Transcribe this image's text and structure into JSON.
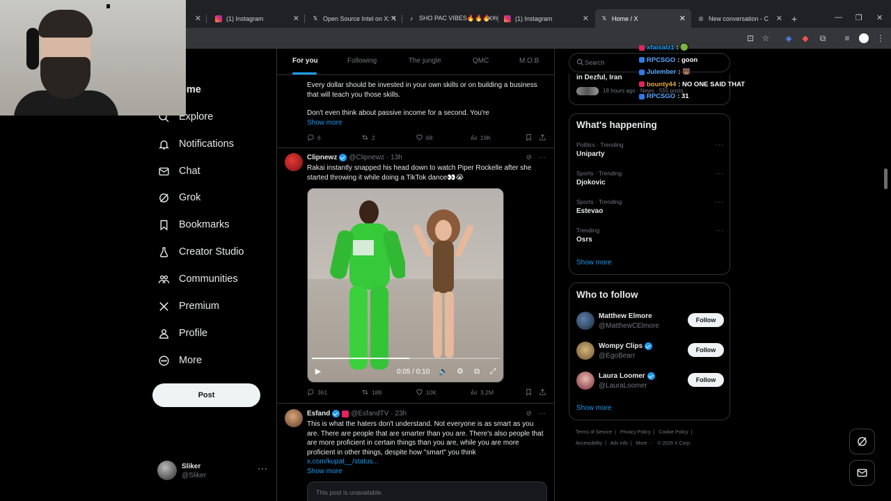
{
  "browser": {
    "tabs": [
      {
        "label": "",
        "favicon": "instagram-icon"
      },
      {
        "label": "(1) Instagram",
        "favicon": "instagram-icon"
      },
      {
        "label": "Open Source Intel on X: \"I",
        "favicon": "x-icon"
      },
      {
        "label": "SHO PAC VIBES🔥🔥🔥 #s",
        "favicon": "tiktok-icon"
      },
      {
        "label": "(1) Instagram",
        "favicon": "instagram-icon"
      },
      {
        "label": "Home / X",
        "favicon": "x-icon"
      },
      {
        "label": "New conversation - C",
        "favicon": "chat-icon"
      }
    ]
  },
  "nav": {
    "home": "ome",
    "explore": "Explore",
    "notifications": "Notifications",
    "chat": "Chat",
    "grok": "Grok",
    "bookmarks": "Bookmarks",
    "creator_studio": "Creator Studio",
    "communities": "Communities",
    "premium": "Premium",
    "profile": "Profile",
    "more": "More",
    "post": "Post"
  },
  "account": {
    "name": "Sliker",
    "handle": "@Sliker"
  },
  "feed_tabs": [
    "For you",
    "Following",
    "The jungle",
    "QMC",
    "M.O.B"
  ],
  "posts": {
    "first": {
      "text1": "Every dollar should be invested in your own skills or on building a business that will teach you those skills.",
      "text2": "Don't even think about passive income for a second. You're",
      "show_more": "Show more",
      "replies": "6",
      "reposts": "2",
      "likes": "68",
      "views": "19K"
    },
    "second": {
      "name": "Clipnewz",
      "handle": "@Clipnewz",
      "time": "· 13h",
      "text": "Rakai instantly snapped his head down to watch Piper Rockelle after she started throwing it while doing a TikTok dance👀😭",
      "video_time": "0:05 / 0:10",
      "progress": 0.52,
      "replies": "361",
      "reposts": "188",
      "likes": "10K",
      "views": "3.2M"
    },
    "third": {
      "name": "Esfand",
      "handle": "@EsfandTV",
      "time": "· 23h",
      "text": "This is what the haters don't understand. Not everyone is as smart as you are. There are people that are smarter than you are. There's also people that are more proficient in certain things than you are, while you are more proficient in other things, despite how \"smart\" you think",
      "link": "x.com/kupat__/status...",
      "show_more": "Show more",
      "quote": "This post is unavailable."
    }
  },
  "right": {
    "search_placeholder": "Search",
    "news_title": "in Dezful, Iran",
    "news_meta": "18 hours ago · News · 555 posts",
    "happening_title": "What's happening",
    "trends": [
      {
        "context": "Politics · Trending",
        "title": "Uniparty"
      },
      {
        "context": "Sports · Trending",
        "title": "Djokovic"
      },
      {
        "context": "Sports · Trending",
        "title": "Estevao"
      },
      {
        "context": "Trending",
        "title": "Osrs"
      }
    ],
    "show_more": "Show more",
    "wtf_title": "Who to follow",
    "wtf": [
      {
        "name": "Matthew Elmore",
        "handle": "@MatthewCElmore",
        "verified": false,
        "follow": "Follow"
      },
      {
        "name": "Wompy Clips",
        "handle": "@EgoBearr",
        "verified": true,
        "follow": "Follow"
      },
      {
        "name": "Laura Loomer",
        "handle": "@LauraLoomer",
        "verified": true,
        "follow": "Follow"
      }
    ],
    "wtf_show_more": "Show more",
    "footer": [
      "Terms of Service",
      "|",
      "Privacy Policy",
      "|",
      "Cookie Policy",
      "|",
      "Accessibility",
      "|",
      "Ads info",
      "|",
      "More ···",
      "© 2026 X Corp."
    ]
  },
  "chat": [
    {
      "user": "xfaisalz1",
      "msg": ": 🟢",
      "color": "#1d9bf0"
    },
    {
      "user": "RPCSGO",
      "msg": ": goon",
      "color": "#5aa7ff"
    },
    {
      "user": "Julember",
      "msg": ": 🐻",
      "color": "#5aa7ff"
    },
    {
      "user": "bounty44",
      "msg": ": NO ONE SAID THAT",
      "color": "#e2a93a"
    },
    {
      "user": "RPCSGO",
      "msg": ": 31",
      "color": "#5aa7ff"
    }
  ],
  "colors": {
    "accent": "#1d9bf0",
    "bg": "#000000",
    "border": "#2f3336",
    "muted": "#71767b"
  }
}
